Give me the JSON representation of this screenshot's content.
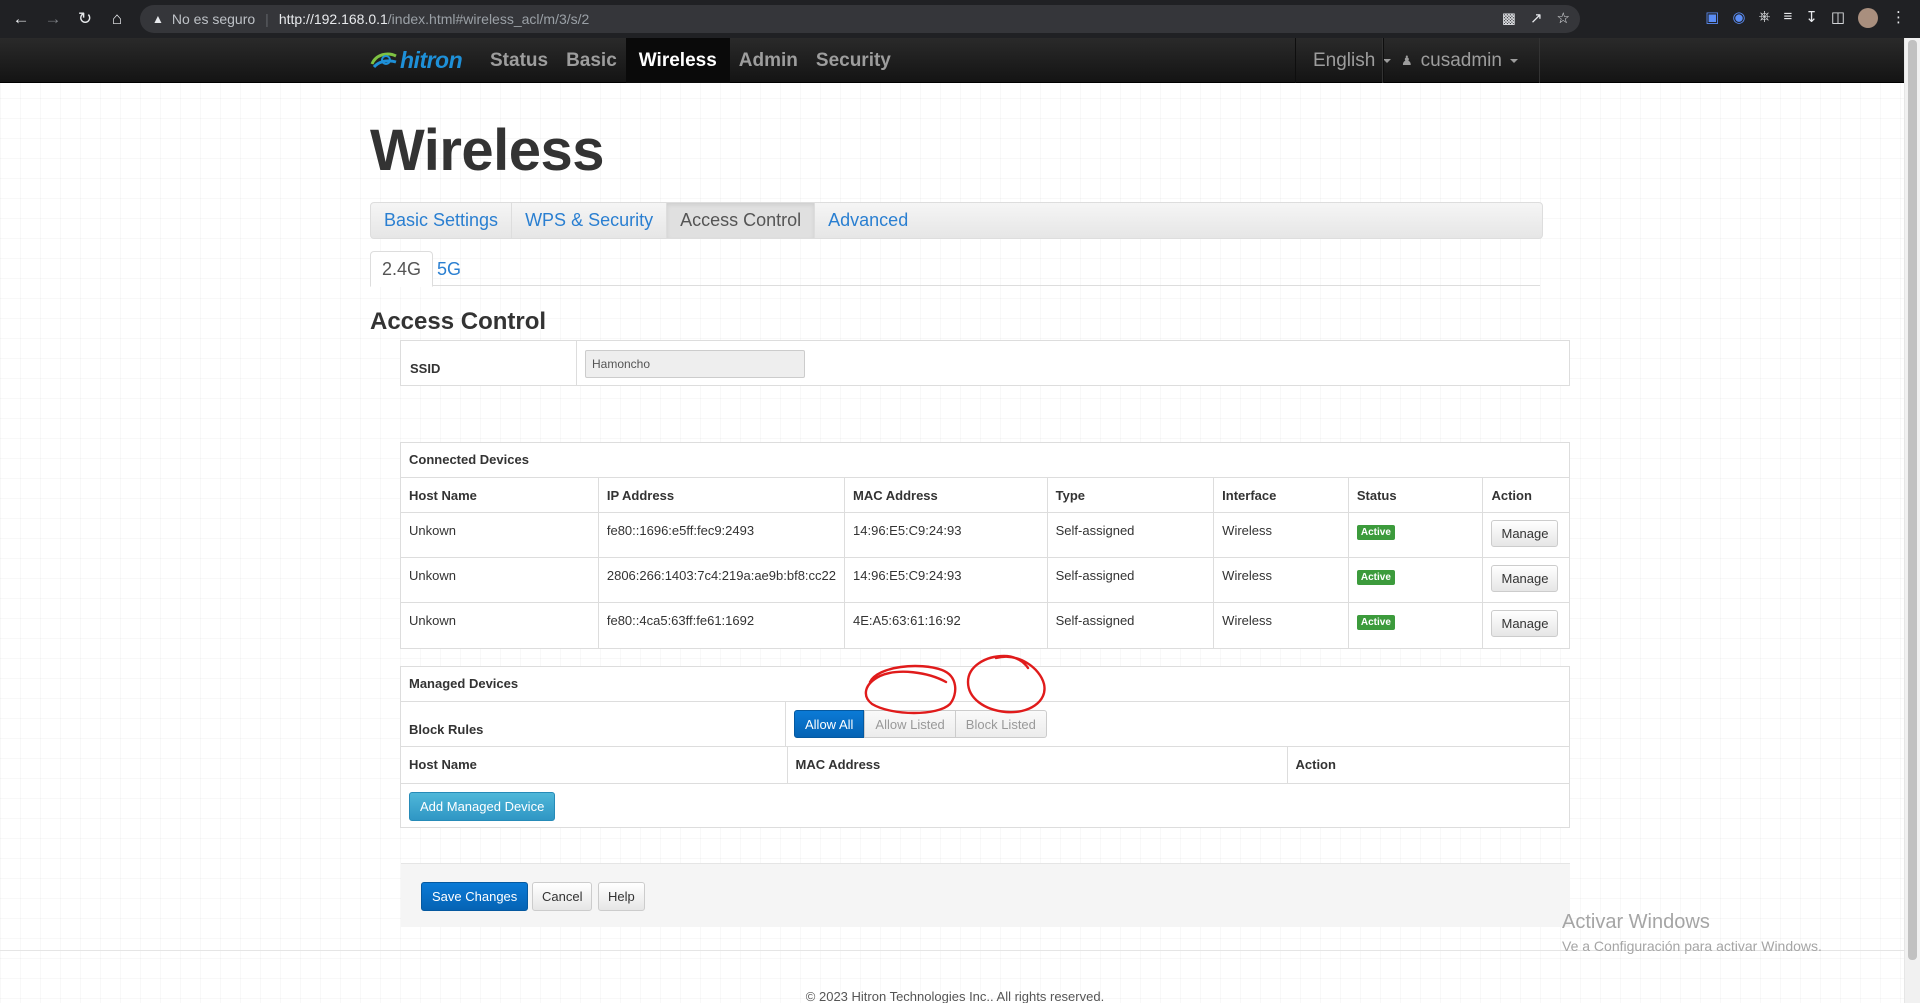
{
  "browser": {
    "security_label": "No es seguro",
    "url_host": "http://192.168.0.1",
    "url_path": "/index.html#wireless_acl/m/3/s/2"
  },
  "nav": {
    "logo": "hitron",
    "items": [
      "Status",
      "Basic",
      "Wireless",
      "Admin",
      "Security"
    ],
    "active": "Wireless",
    "language": "English",
    "user": "cusadmin"
  },
  "page_title": "Wireless",
  "tabs": [
    "Basic Settings",
    "WPS & Security",
    "Access Control",
    "Advanced"
  ],
  "active_tab": "Access Control",
  "subtabs": [
    "2.4G",
    "5G"
  ],
  "section_title": "Access Control",
  "ssid": {
    "label": "SSID",
    "value": "Hamoncho"
  },
  "connected": {
    "title": "Connected Devices",
    "columns": [
      "Host Name",
      "IP Address",
      "MAC Address",
      "Type",
      "Interface",
      "Status",
      "Action"
    ],
    "rows": [
      {
        "host": "Unkown",
        "ip": "fe80::1696:e5ff:fec9:2493",
        "mac": "14:96:E5:C9:24:93",
        "type": "Self-assigned",
        "iface": "Wireless",
        "status": "Active",
        "action": "Manage"
      },
      {
        "host": "Unkown",
        "ip": "2806:266:1403:7c4:219a:ae9b:bf8:cc22",
        "mac": "14:96:E5:C9:24:93",
        "type": "Self-assigned",
        "iface": "Wireless",
        "status": "Active",
        "action": "Manage"
      },
      {
        "host": "Unkown",
        "ip": "fe80::4ca5:63ff:fe61:1692",
        "mac": "4E:A5:63:61:16:92",
        "type": "Self-assigned",
        "iface": "Wireless",
        "status": "Active",
        "action": "Manage"
      }
    ]
  },
  "managed": {
    "title": "Managed Devices",
    "rules_label": "Block Rules",
    "rules": [
      "Allow All",
      "Allow Listed",
      "Block Listed"
    ],
    "selected_rule": "Allow All",
    "columns": [
      "Host Name",
      "MAC Address",
      "Action"
    ],
    "add_button": "Add Managed Device"
  },
  "actions": {
    "save": "Save Changes",
    "cancel": "Cancel",
    "help": "Help"
  },
  "footer": "© 2023 Hitron Technologies Inc.. All rights reserved.",
  "watermark": {
    "line1": "Activar Windows",
    "line2": "Ve a Configuración para activar Windows."
  },
  "colors": {
    "accent": "#0563b4",
    "link": "#2a7fd1",
    "badge": "#3c9b3c",
    "annotation": "#e01b1b"
  }
}
